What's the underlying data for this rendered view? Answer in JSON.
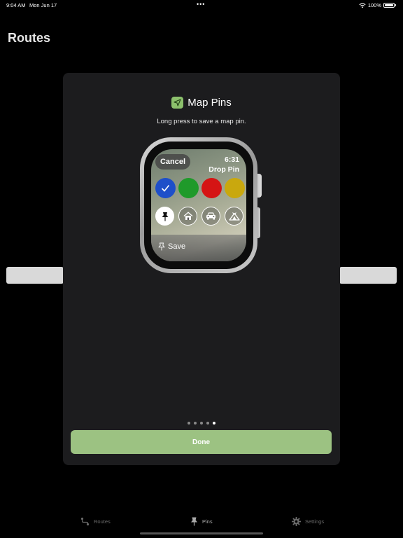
{
  "status_bar": {
    "time": "9:04 AM",
    "date": "Mon Jun 17",
    "multitask_dots": "•••",
    "battery": "100%",
    "icons": [
      "wifi-icon",
      "battery-icon"
    ]
  },
  "background": {
    "title": "Routes"
  },
  "modal": {
    "title": "Map Pins",
    "app_icon": "location-arrow-icon",
    "subtitle": "Long press to save a map pin.",
    "done_label": "Done",
    "page_count": 5,
    "active_page": 5
  },
  "watch": {
    "cancel_label": "Cancel",
    "time": "6:31",
    "title": "Drop Pin",
    "colors": [
      "#1e4fc9",
      "#1f9a2a",
      "#d51414",
      "#c9a80e"
    ],
    "selected_color": "#1e4fc9",
    "pin_icons": [
      "pin-icon",
      "house-icon",
      "car-icon",
      "tent-icon"
    ],
    "selected_icon": "pin-icon",
    "save_label": "Save"
  },
  "tab_bar": {
    "tabs": [
      {
        "label": "Routes",
        "icon": "route-icon"
      },
      {
        "label": "Pins",
        "icon": "pin-icon"
      },
      {
        "label": "Settings",
        "icon": "gear-icon"
      }
    ],
    "active": "Pins"
  },
  "colors": {
    "done_button": "#9cc282",
    "app_icon": "#8cc06c",
    "modal_bg": "#1c1c1e"
  }
}
